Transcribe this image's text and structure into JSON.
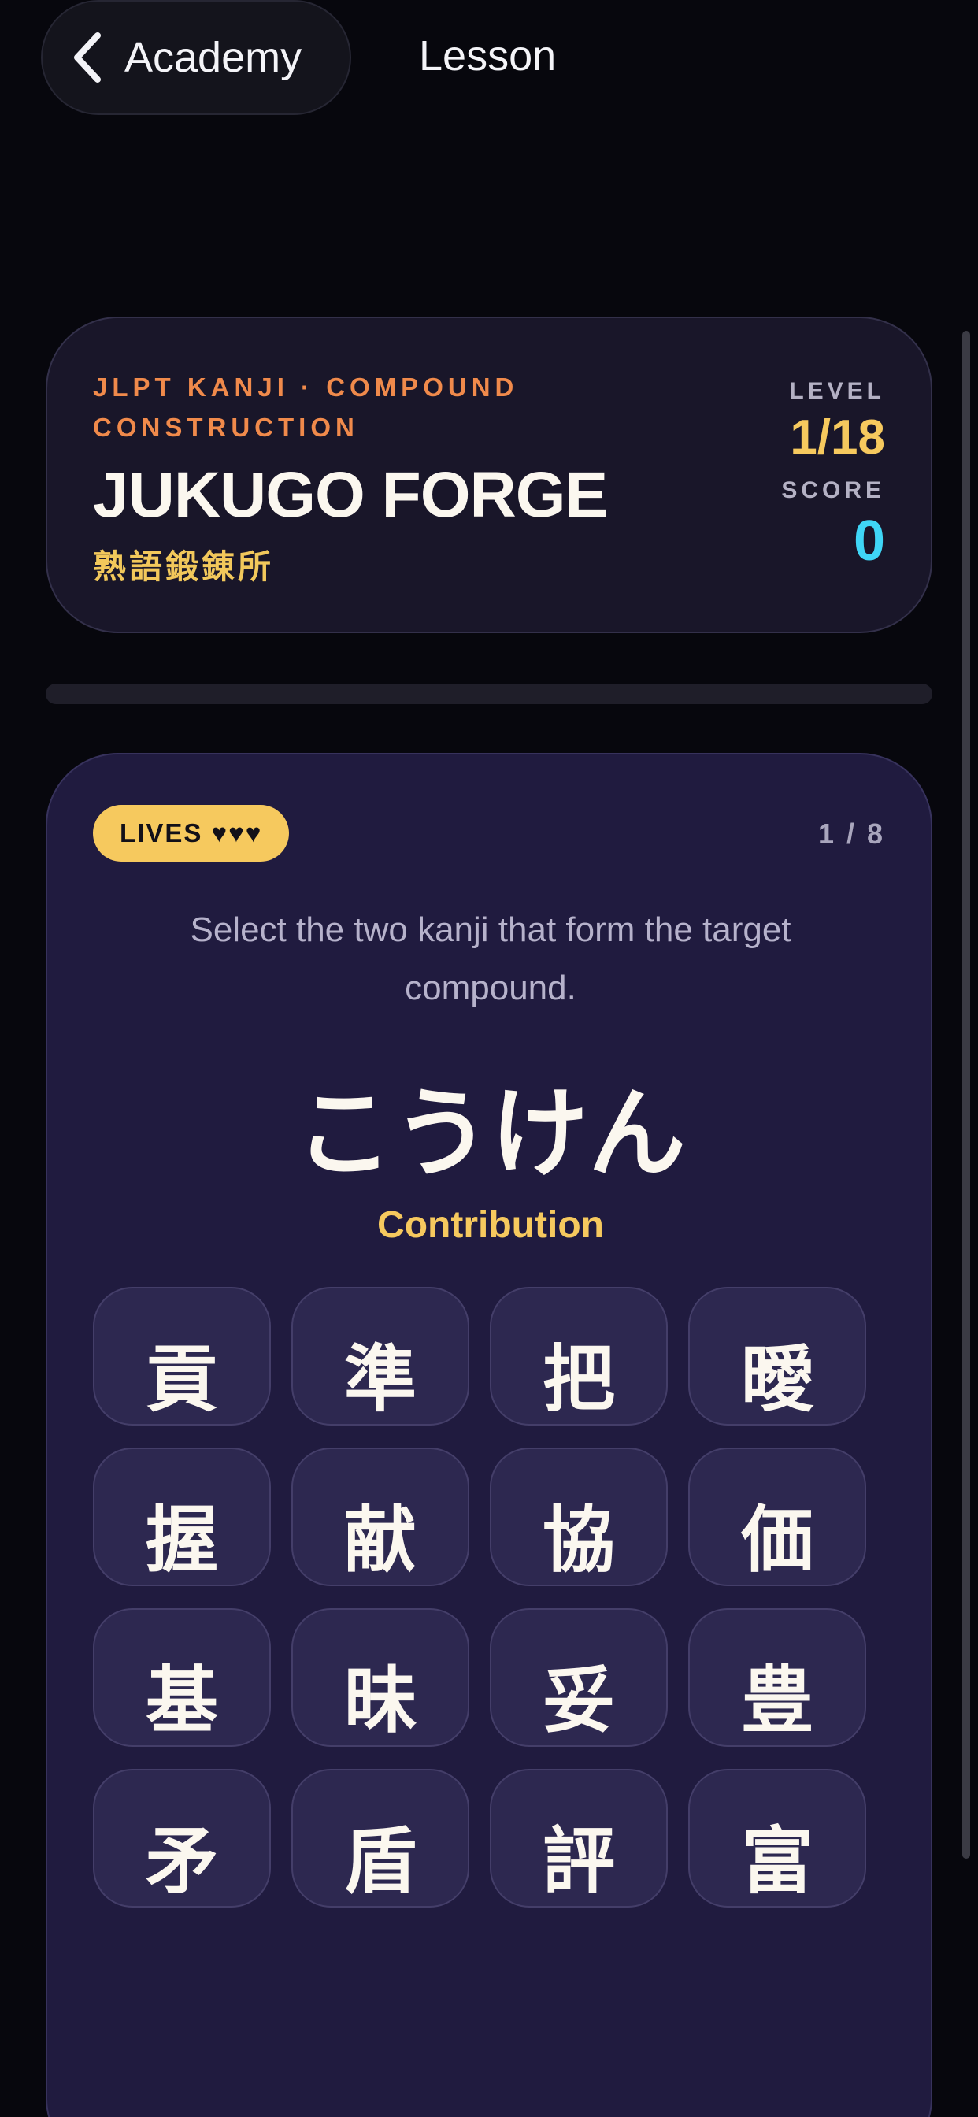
{
  "nav": {
    "back_label": "Academy",
    "title": "Lesson"
  },
  "header": {
    "subtitle": "JLPT KANJI · COMPOUND CONSTRUCTION",
    "title": "JUKUGO FORGE",
    "jp_title": "熟語鍛錬所",
    "level_label": "LEVEL",
    "level_value": "1/18",
    "score_label": "SCORE",
    "score_value": "0"
  },
  "progress": {
    "fraction": 0
  },
  "game": {
    "lives_label": "LIVES ♥♥♥",
    "counter": "1 / 8",
    "instruction": "Select the two kanji that form the target compound.",
    "reading": "こうけん",
    "meaning": "Contribution",
    "tiles": [
      "貢",
      "準",
      "把",
      "曖",
      "握",
      "献",
      "協",
      "価",
      "基",
      "昧",
      "妥",
      "豊",
      "矛",
      "盾",
      "評",
      "富"
    ]
  },
  "colors": {
    "background": "#07070d",
    "accent_gold": "#f6c95e",
    "accent_orange": "#f08a4b",
    "accent_cyan": "#3fd6f6",
    "card": "#201b3f"
  },
  "icons": {
    "back": "chevron-left-icon"
  }
}
